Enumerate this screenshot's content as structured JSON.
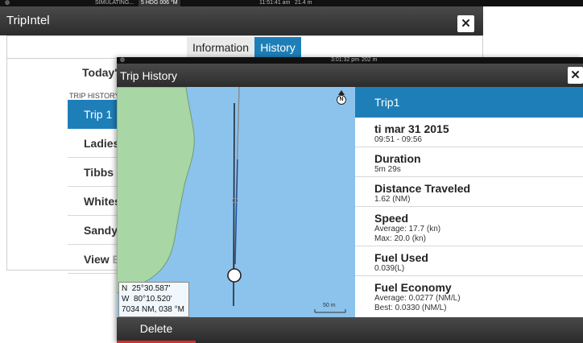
{
  "back_window": {
    "status": {
      "simulating": "SIMULATING...",
      "hdg": "5 HDG 006 °M",
      "time": "11:51:41 am",
      "depth": "21.4 m"
    },
    "title": "TripIntel",
    "close_glyph": "✕",
    "tabs": [
      {
        "label": "Information",
        "active": false
      },
      {
        "label": "History",
        "active": true
      }
    ],
    "today_label": "Today's",
    "history_header": "TRIP HISTORY",
    "items": [
      {
        "main": "Trip 1",
        "rest": "",
        "selected": true
      },
      {
        "main": "Ladies",
        "rest": "B",
        "selected": false
      },
      {
        "main": "Tibbs",
        "rest": "Be",
        "selected": false
      },
      {
        "main": "Whites",
        "rest": "E",
        "selected": false
      },
      {
        "main": "Sandy",
        "rest": "B",
        "selected": false
      },
      {
        "main": "View",
        "rest": "Ba",
        "selected": false
      }
    ]
  },
  "front_window": {
    "status": {
      "time": "3:01:32 pm",
      "depth": "202 m"
    },
    "title": "Trip History",
    "close_glyph": "✕",
    "map": {
      "north_label": "N",
      "coord_lat": "N  25°30.587'",
      "coord_lon": "W  80°10.520'",
      "coord_range": "7034 NM, 038 °M",
      "scale_label": "50 m",
      "colors": {
        "water": "#8cc3ec",
        "land": "#a8d6a4"
      }
    },
    "details": {
      "selected_trip": "Trip1",
      "date": "ti mar 31 2015",
      "time_range": "09:51 - 09:56",
      "duration_label": "Duration",
      "duration_value": "5m 29s",
      "distance_label": "Distance Traveled",
      "distance_value": "1.62 (NM)",
      "speed_label": "Speed",
      "speed_avg": "Average: 17.7 (kn)",
      "speed_max": "Max: 20.0 (kn)",
      "fuel_used_label": "Fuel Used",
      "fuel_used_value": "0.039(L)",
      "fuel_economy_label": "Fuel Economy",
      "fuel_economy_avg": "Average: 0.0277 (NM/L)",
      "fuel_economy_best": "Best: 0.0330 (NM/L)"
    },
    "toolbar": {
      "delete_label": "Delete"
    },
    "accent": "#1e7fb8"
  }
}
